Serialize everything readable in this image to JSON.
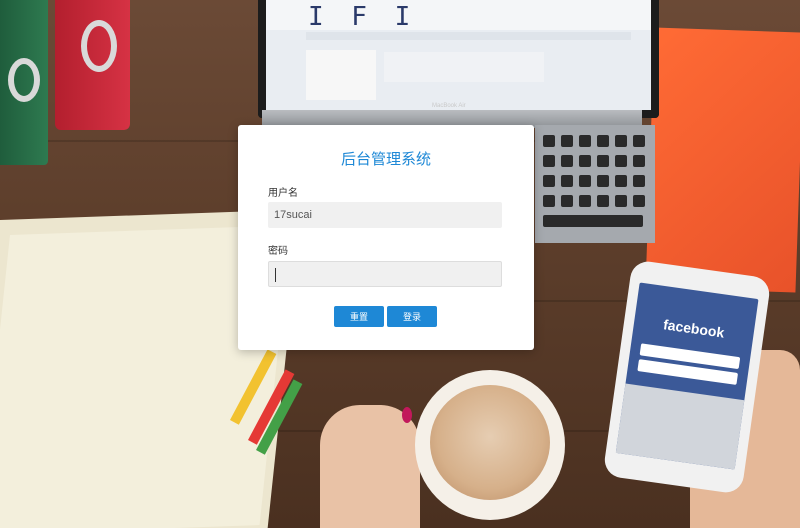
{
  "login": {
    "title": "后台管理系统",
    "username_label": "用户名",
    "username_value": "17sucai",
    "password_label": "密码",
    "password_value": "",
    "reset_button": "重置",
    "login_button": "登录"
  },
  "background": {
    "laptop_brand": "MacBook Air",
    "laptop_logo": "I F I",
    "phone_app": "facebook"
  },
  "colors": {
    "accent": "#1e88d6",
    "card": "#ffffff",
    "input_bg": "#f0f0f0"
  }
}
